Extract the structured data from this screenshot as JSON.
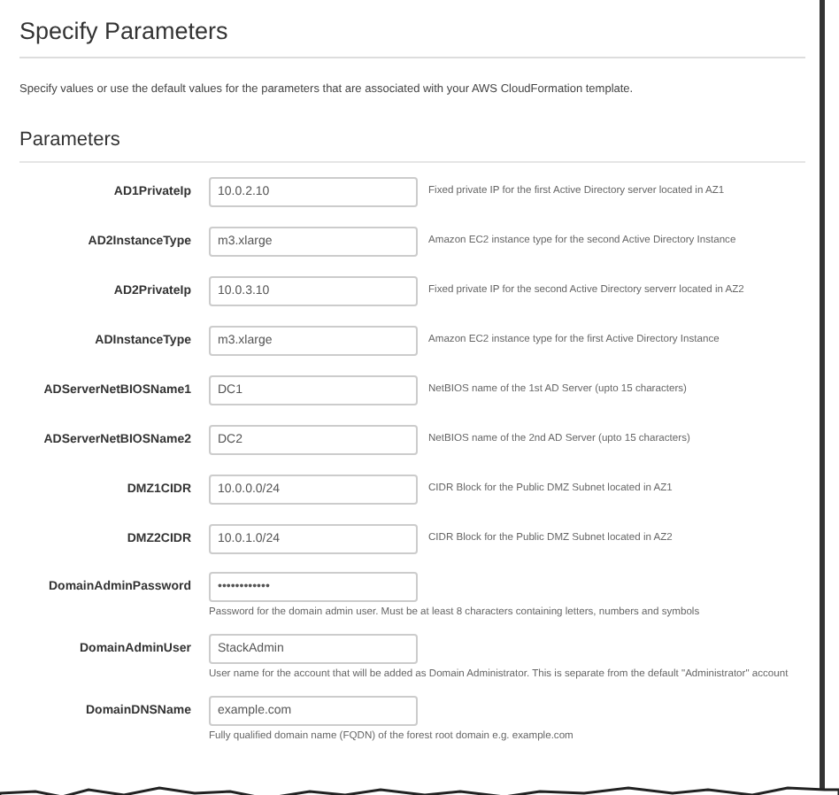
{
  "title": "Specify Parameters",
  "intro": "Specify values or use the default values for the parameters that are associated with your AWS CloudFormation template.",
  "section_title": "Parameters",
  "parameters": [
    {
      "label": "AD1PrivateIp",
      "value": "10.0.2.10",
      "kind": "inline",
      "description": "Fixed private IP for the first Active Directory server located in AZ1"
    },
    {
      "label": "AD2InstanceType",
      "value": "m3.xlarge",
      "kind": "inline",
      "description": "Amazon EC2 instance type for the second Active Directory Instance"
    },
    {
      "label": "AD2PrivateIp",
      "value": "10.0.3.10",
      "kind": "inline",
      "description": "Fixed private IP for the second Active Directory serverr located in AZ2"
    },
    {
      "label": "ADInstanceType",
      "value": "m3.xlarge",
      "kind": "inline",
      "description": "Amazon EC2 instance type for the first Active Directory Instance"
    },
    {
      "label": "ADServerNetBIOSName1",
      "value": "DC1",
      "kind": "inline",
      "description": "NetBIOS name of the 1st AD Server (upto 15 characters)"
    },
    {
      "label": "ADServerNetBIOSName2",
      "value": "DC2",
      "kind": "inline",
      "description": "NetBIOS name of the 2nd AD Server (upto 15 characters)"
    },
    {
      "label": "DMZ1CIDR",
      "value": "10.0.0.0/24",
      "kind": "inline",
      "description": "CIDR Block for the Public DMZ Subnet located in AZ1"
    },
    {
      "label": "DMZ2CIDR",
      "value": "10.0.1.0/24",
      "kind": "inline",
      "description": "CIDR Block for the Public DMZ Subnet located in AZ2"
    },
    {
      "label": "DomainAdminPassword",
      "value": "••••••••••••",
      "kind": "below",
      "description": "Password for the domain admin user. Must be at least 8 characters containing letters, numbers and symbols"
    },
    {
      "label": "DomainAdminUser",
      "value": "StackAdmin",
      "kind": "below",
      "description": "User name for the account that will be added as Domain Administrator. This is separate from the default \"Administrator\" account"
    },
    {
      "label": "DomainDNSName",
      "value": "example.com",
      "kind": "below",
      "description": "Fully qualified domain name (FQDN) of the forest root domain e.g. example.com"
    }
  ]
}
